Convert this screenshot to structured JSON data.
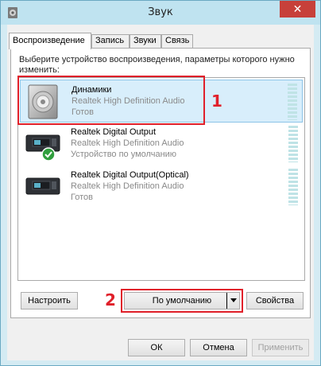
{
  "window": {
    "title": "Звук",
    "close_label": "✕"
  },
  "tabs": [
    {
      "label": "Воспроизведение",
      "active": true
    },
    {
      "label": "Запись"
    },
    {
      "label": "Звуки"
    },
    {
      "label": "Связь"
    }
  ],
  "panel": {
    "instructions": "Выберите устройство воспроизведения, параметры которого нужно изменить:"
  },
  "devices": [
    {
      "name": "Динамики",
      "driver": "Realtek High Definition Audio",
      "status": "Готов",
      "icon": "speaker-icon",
      "selected": true
    },
    {
      "name": "Realtek Digital Output",
      "driver": "Realtek High Definition Audio",
      "status": "Устройство по умолчанию",
      "icon": "digital-output-icon",
      "default": true
    },
    {
      "name": "Realtek Digital Output(Optical)",
      "driver": "Realtek High Definition Audio",
      "status": "Готов",
      "icon": "digital-output-icon"
    }
  ],
  "annotations": {
    "marker_1": "1",
    "marker_2": "2",
    "color": "#e0202a"
  },
  "buttons": {
    "configure": "Настроить",
    "set_default": "По умолчанию",
    "properties": "Свойства",
    "ok": "ОК",
    "cancel": "Отмена",
    "apply": "Применить"
  }
}
